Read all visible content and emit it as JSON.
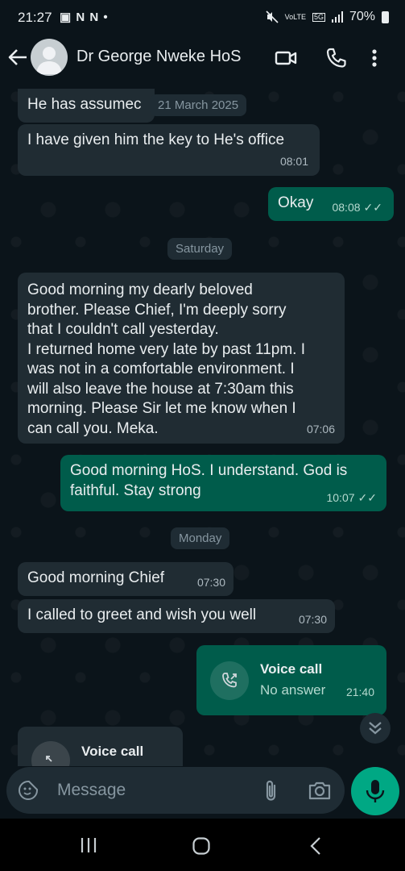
{
  "status_bar": {
    "time": "21:27",
    "left_icons": "▣ N N •",
    "network_top": "VoLTE",
    "network_5g": "5G",
    "battery": "70%"
  },
  "header": {
    "back_icon": "arrow-left",
    "contact_name": "Dr George Nweke HoS",
    "video_icon": "video-camera",
    "call_icon": "phone",
    "menu_icon": "more-vertical"
  },
  "date_pills": {
    "top_date": "21 March 2025",
    "saturday": "Saturday",
    "monday": "Monday"
  },
  "messages": [
    {
      "id": "m1",
      "dir": "in",
      "text": "He has assumec",
      "time": ""
    },
    {
      "id": "m2",
      "dir": "in",
      "text": "I have given him the key to He's office",
      "time": "08:01"
    },
    {
      "id": "m3",
      "dir": "out",
      "text": "Okay",
      "time": "08:08",
      "status": "read"
    },
    {
      "id": "m4",
      "dir": "in",
      "lines": [
        "Good morning my dearly beloved",
        "brother.  Please Chief, I'm deeply sorry",
        "that I couldn't  call yesterday.",
        "I returned home very late by past 11pm. I",
        "was not in a comfortable environment.  I",
        "will also leave the house at 7:30am this",
        "morning. Please Sir let me know when I",
        "can call you. Meka."
      ],
      "time": "07:06"
    },
    {
      "id": "m5",
      "dir": "out",
      "lines": [
        "Good morning HoS. I understand. God is",
        "faithful. Stay strong"
      ],
      "time": "10:07",
      "status": "read"
    },
    {
      "id": "m6",
      "dir": "in",
      "text": "Good morning Chief",
      "time": "07:30"
    },
    {
      "id": "m7",
      "dir": "in",
      "text": "I called to greet and wish you well",
      "time": "07:30"
    },
    {
      "id": "m8",
      "dir": "out",
      "type": "call",
      "title": "Voice call",
      "subtitle": "No answer",
      "time": "21:40"
    },
    {
      "id": "m9",
      "dir": "in",
      "type": "call",
      "title": "Voice call"
    }
  ],
  "ticks_glyph": "✓✓",
  "input": {
    "placeholder": "Message",
    "emoji_icon": "sticker-smile",
    "attach_icon": "paperclip",
    "camera_icon": "camera",
    "mic_icon": "microphone"
  },
  "colors": {
    "background": "#0b141a",
    "incoming_bubble": "#202c33",
    "outgoing_bubble": "#005c4b",
    "accent": "#00a884"
  },
  "nav_bar": {
    "recents_icon": "recent-apps",
    "home_icon": "home-circle",
    "back_icon": "chevron-left"
  }
}
